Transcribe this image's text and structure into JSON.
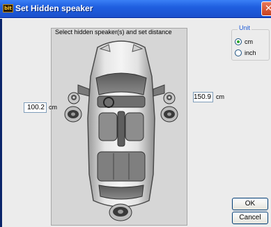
{
  "window": {
    "title": "Set Hidden speaker",
    "app_icon_text": "bit",
    "close_glyph": "✕"
  },
  "panel": {
    "instruction": "Select hidden speaker(s) and set distance"
  },
  "left_distance": {
    "value": "100.2",
    "unit": "cm"
  },
  "right_distance": {
    "value": "150.9",
    "unit": "cm"
  },
  "unit_group": {
    "title": "Unit",
    "options": [
      {
        "label": "cm",
        "selected": true
      },
      {
        "label": "inch",
        "selected": false
      }
    ]
  },
  "buttons": {
    "ok": "OK",
    "cancel": "Cancel"
  },
  "colors": {
    "title_blue": "#1f5fe0",
    "unit_title": "#1e5bd6",
    "radio_dot": "#2aa52a"
  }
}
